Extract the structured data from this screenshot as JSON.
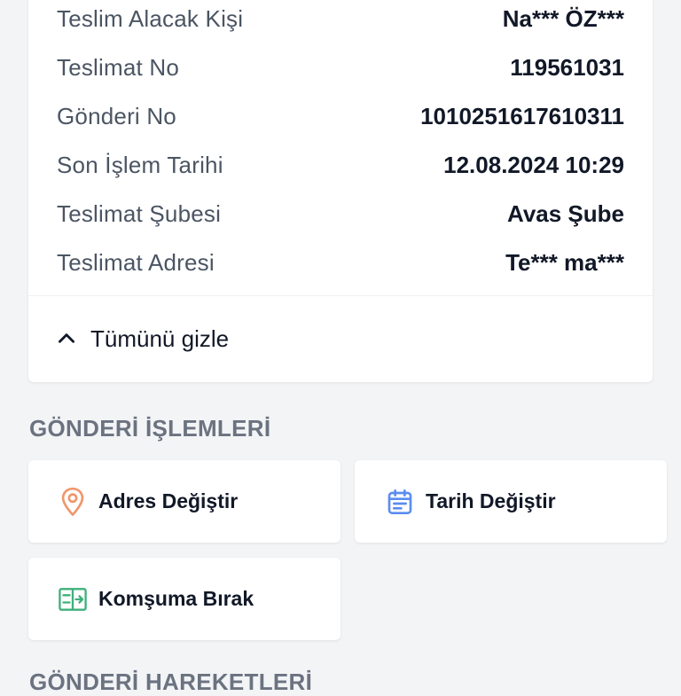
{
  "details": {
    "rows": [
      {
        "label": "Teslim Alacak Kişi",
        "value": "Na*** ÖZ***"
      },
      {
        "label": "Teslimat No",
        "value": "119561031"
      },
      {
        "label": "Gönderi No",
        "value": "1010251617610311"
      },
      {
        "label": "Son İşlem Tarihi",
        "value": "12.08.2024 10:29"
      },
      {
        "label": "Teslimat Şubesi",
        "value": "Avas Şube"
      },
      {
        "label": "Teslimat Adresi",
        "value": "Te*** ma***"
      }
    ],
    "collapse_label": "Tümünü gizle"
  },
  "actions_section": {
    "title": "GÖNDERİ İŞLEMLERİ",
    "items": [
      {
        "label": "Adres Değiştir",
        "icon": "location-pin-icon",
        "icon_color": "#f0966b"
      },
      {
        "label": "Tarih Değiştir",
        "icon": "calendar-icon",
        "icon_color": "#5b8def"
      },
      {
        "label": "Komşuma Bırak",
        "icon": "transfer-box-icon",
        "icon_color": "#3fb07a"
      }
    ]
  },
  "movements_section": {
    "title": "GÖNDERİ HAREKETLERİ"
  }
}
